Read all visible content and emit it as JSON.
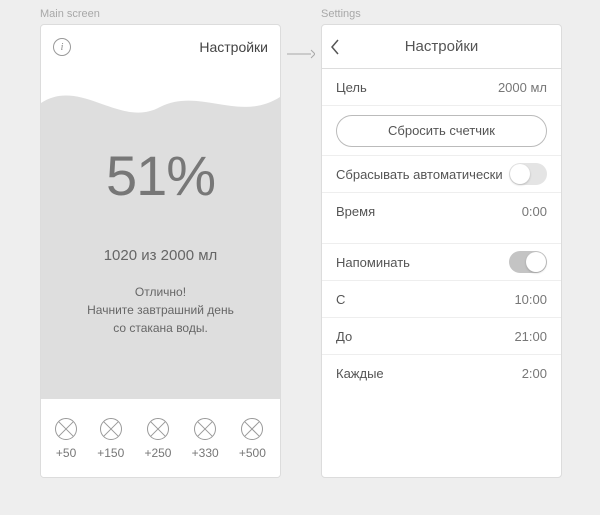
{
  "captions": {
    "main": "Main screen",
    "settings": "Settings"
  },
  "main": {
    "settings_link": "Настройки",
    "percent": "51%",
    "progress": "1020 из 2000 мл",
    "cheer_title": "Отлично!",
    "cheer_line1": "Начните завтрашний день",
    "cheer_line2": "со стакана воды.",
    "add_buttons": [
      "+50",
      "+150",
      "+250",
      "+330",
      "+500"
    ]
  },
  "settings": {
    "title": "Настройки",
    "goal_label": "Цель",
    "goal_value": "2000 мл",
    "reset_label": "Сбросить счетчик",
    "auto_reset_label": "Сбрасывать автоматически",
    "auto_reset_on": false,
    "time_label": "Время",
    "time_value": "0:00",
    "remind_label": "Напоминать",
    "remind_on": true,
    "from_label": "С",
    "from_value": "10:00",
    "to_label": "До",
    "to_value": "21:00",
    "every_label": "Каждые",
    "every_value": "2:00"
  }
}
